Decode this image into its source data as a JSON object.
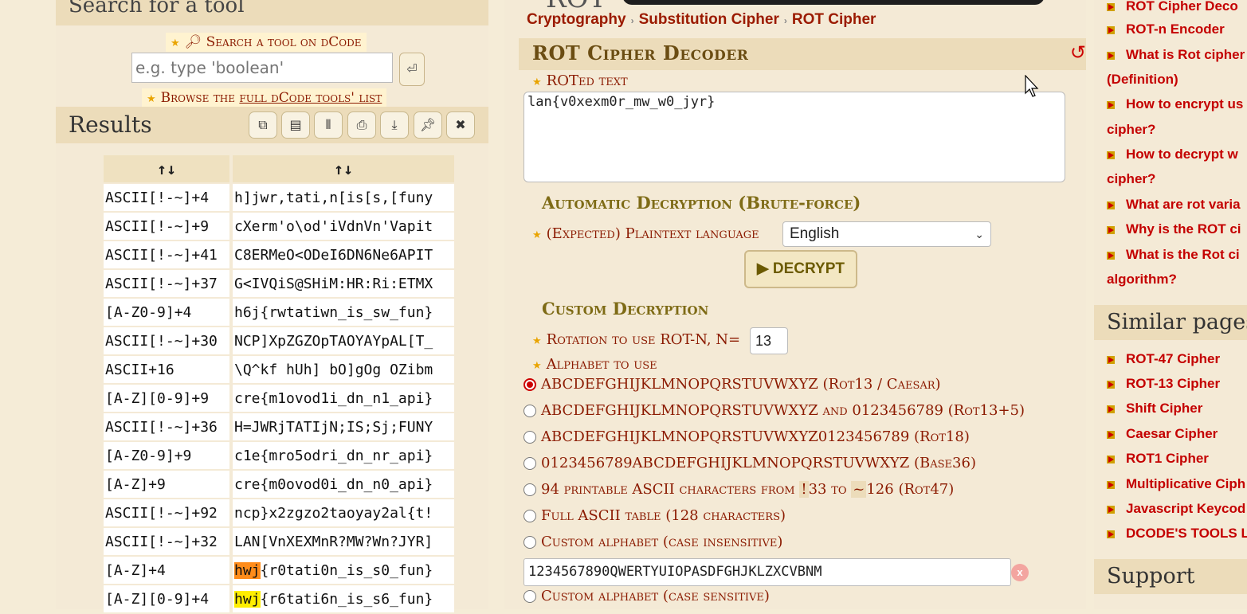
{
  "search": {
    "heading": "Search for a tool",
    "link_label": "Search a tool on dCode",
    "placeholder": "e.g. type 'boolean'",
    "browse_prefix": "Browse the ",
    "browse_link": "full dCode tools' list"
  },
  "results": {
    "title": "Results",
    "columns": [
      "↑↓",
      "↑↓"
    ],
    "rows": [
      {
        "method": "ASCII[!-~]+4",
        "text": "h]jwr,tati,n[is[s,[funy",
        "hl": ""
      },
      {
        "method": "ASCII[!-~]+9",
        "text": "cXerm'o\\od'iVdnVn'Vapit",
        "hl": ""
      },
      {
        "method": "ASCII[!-~]+41",
        "text": "C8ERMeO<ODeI6DN6Ne6APIT",
        "hl": ""
      },
      {
        "method": "ASCII[!-~]+37",
        "text": "G<IVQiS@SHiM:HR:Ri:ETMX",
        "hl": ""
      },
      {
        "method": "[A-Z0-9]+4",
        "text": "h6j{rwtatiwn_is_sw_fun}",
        "hl": ""
      },
      {
        "method": "ASCII[!-~]+30",
        "text": "NCP]XpZGZOpTAOYAYpAL[T_",
        "hl": ""
      },
      {
        "method": "ASCII+16",
        "text": "\\Q^kf hUh] bO]gOg OZibm",
        "hl": ""
      },
      {
        "method": "[A-Z][0-9]+9",
        "text": "cre{m1ovod1i_dn_n1_api}",
        "hl": ""
      },
      {
        "method": "ASCII[!-~]+36",
        "text": "H=JWRjTATIjN;IS;Sj;FUNY",
        "hl": ""
      },
      {
        "method": "[A-Z0-9]+9",
        "text": "c1e{mro5odri_dn_nr_api}",
        "hl": ""
      },
      {
        "method": "[A-Z]+9",
        "text": "cre{m0ovod0i_dn_n0_api}",
        "hl": ""
      },
      {
        "method": "ASCII[!-~]+92",
        "text": "ncp}x2zgzo2taoyay2al{t!",
        "hl": ""
      },
      {
        "method": "ASCII[!-~]+32",
        "text": "LAN[VnXEXMnR?MW?Wn?JYR]",
        "hl": ""
      },
      {
        "method": "[A-Z]+4",
        "text": "{r0tati0n_is_s0_fun}",
        "hl": "hwj",
        "hl_color": "orange"
      },
      {
        "method": "[A-Z][0-9]+4",
        "text": "{r6tati6n_is_s6_fun}",
        "hl": "hwj",
        "hl_color": "yellow"
      }
    ]
  },
  "breadcrumb": [
    "Cryptography",
    "Substitution Cipher",
    "ROT Cipher"
  ],
  "title_cut": "ROT",
  "decoder": {
    "title": "ROT Cipher Decoder",
    "text_label": "ROTed text",
    "text_value": "lan{v0xexm0r_mw_w0_jyr}",
    "auto_heading": "Automatic Decryption (Brute-force)",
    "lang_label": "(Expected) Plaintext language",
    "lang_value": "English",
    "decrypt_label": "DECRYPT",
    "custom_heading": "Custom Decryption",
    "rotation_label": "Rotation to use ROT-N, N=",
    "rotation_value": "13",
    "alphabet_label": "Alphabet to use",
    "alphabets": [
      {
        "label": "ABCDEFGHIJKLMNOPQRSTUVWXYZ (Rot13 / Caesar)",
        "selected": true
      },
      {
        "label": "ABCDEFGHIJKLMNOPQRSTUVWXYZ and 0123456789 (Rot13+5)",
        "selected": false
      },
      {
        "label": "ABCDEFGHIJKLMNOPQRSTUVWXYZ0123456789 (Rot18)",
        "selected": false
      },
      {
        "label": "0123456789ABCDEFGHIJKLMNOPQRSTUVWXYZ (Base36)",
        "selected": false
      }
    ],
    "ascii94": {
      "pre": "94 printable ASCII characters from ",
      "c1": "!",
      "m1": "33 to ",
      "c2": "~",
      "m2": "126 (Rot47)"
    },
    "full_ascii": "Full ASCII table (128 characters)",
    "custom_ci": "Custom alphabet (case insensitive)",
    "custom_value": "1234567890QWERTYUIOPASDFGHJKLZXCVBNM",
    "custom_cs": "Custom alphabet (case sensitive)",
    "clear": "x"
  },
  "sidebar": {
    "top_links": [
      "ROT Cipher Decoder",
      "ROT-n Encoder",
      "What is Rot cipher? (Definition)",
      "How to encrypt using ROT cipher?",
      "How to decrypt with ROT cipher?",
      "What are rot variants?",
      "Why is the ROT cipher",
      "What is the Rot cipher algorithm?"
    ],
    "top_links_display": [
      "ROT Cipher Deco",
      "ROT-n Encoder",
      "What is Rot cipher",
      "(Definition)",
      "How to encrypt us",
      "cipher?",
      "How to decrypt w",
      "cipher?",
      "What are rot varia",
      "Why is the ROT ci",
      "What is the Rot ci",
      "algorithm?"
    ],
    "similar_heading": "Similar pages",
    "similar": [
      "ROT-47 Cipher",
      "ROT-13 Cipher",
      "Shift Cipher",
      "Caesar Cipher",
      "ROT1 Cipher",
      "Multiplicative Ciph",
      "Javascript Keycod",
      "DCODE'S TOOLS LI"
    ],
    "support_heading": "Support"
  }
}
